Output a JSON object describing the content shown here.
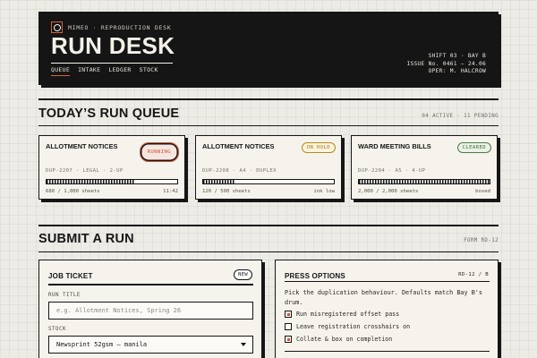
{
  "header": {
    "brand": "MIMEO · REPRODUCTION DESK",
    "title": "RUN DESK",
    "nav": [
      "QUEUE",
      "INTAKE",
      "LEDGER",
      "STOCK"
    ],
    "meta": [
      "SHIFT 03 · BAY B",
      "ISSUE No. 0461 — 24.06",
      "OPER: M. HALCROW"
    ]
  },
  "queue": {
    "title": "TODAY’S RUN QUEUE",
    "aside": "04 ACTIVE · 11 PENDING",
    "cards": [
      {
        "title": "ALLOTMENT NOTICES",
        "status": "RUNNING",
        "meta": "DUP-2207 · LEGAL · 2-UP",
        "progress": 0.68,
        "foot_left": "680 / 1,000 sheets",
        "foot_right": "11:42"
      },
      {
        "title": "ALLOTMENT NOTICES",
        "status": "ON HOLD",
        "meta": "DUP-2208 · A4 · DUPLEX",
        "progress": 0.24,
        "foot_left": "120 / 500 sheets",
        "foot_right": "ink low"
      },
      {
        "title": "WARD MEETING BILLS",
        "status": "CLEARED",
        "meta": "DUP-2204 · A5 · 4-UP",
        "progress": 1.0,
        "foot_left": "2,000 / 2,000 sheets",
        "foot_right": "boxed"
      }
    ]
  },
  "submit": {
    "title": "SUBMIT A RUN",
    "aside": "FORM RD-12"
  },
  "job_ticket": {
    "title": "JOB TICKET",
    "badge": "NEW",
    "run_title_label": "RUN TITLE",
    "run_title_placeholder": "e.g. Allotment Notices, Spring 26",
    "stock_label": "STOCK",
    "stock_value": "Newsprint 52gsm — manila"
  },
  "press_options": {
    "title": "PRESS OPTIONS",
    "aside": "RD-12 / B",
    "description": "Pick the duplication behaviour. Defaults match Bay B's drum.",
    "options": [
      {
        "label": "Run misregistered offset pass",
        "checked": true
      },
      {
        "label": "Leave registration crosshairs on",
        "checked": false
      },
      {
        "label": "Collate & box on completion",
        "checked": true
      }
    ]
  }
}
